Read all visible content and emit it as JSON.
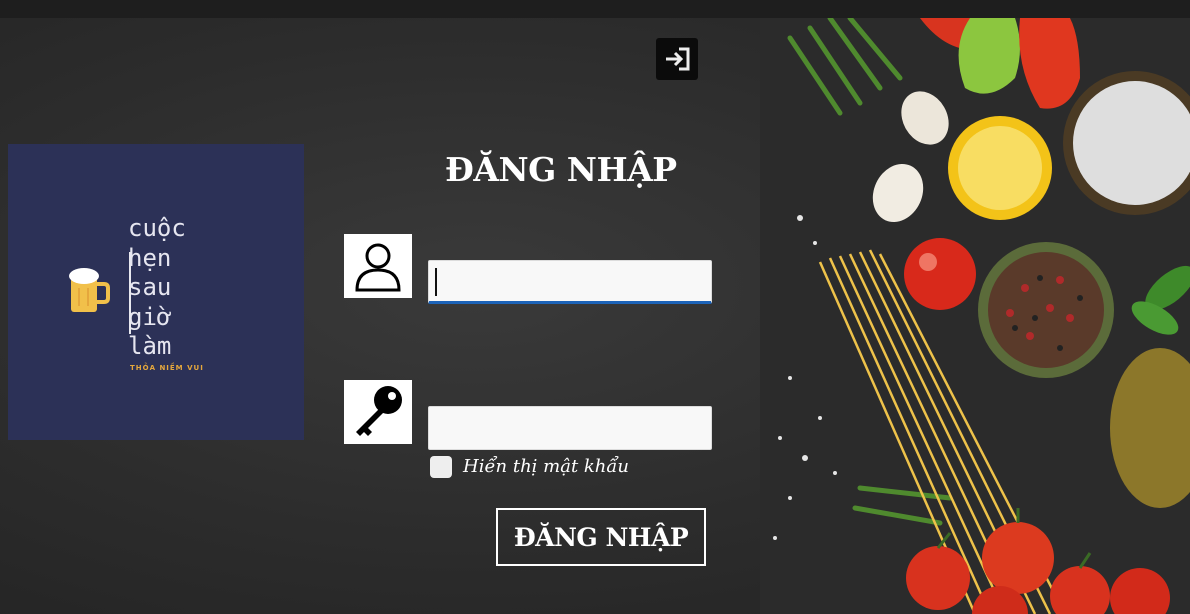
{
  "logo": {
    "lines": [
      "cuộc",
      "hẹn",
      "sau",
      "giờ",
      "làm"
    ],
    "tagline": "THỎA NIỀM VUI",
    "icon": "beer-mug-icon",
    "background_color": "#2c3157",
    "accent_color": "#e5a73c"
  },
  "header": {
    "exit_icon": "sign-in-icon"
  },
  "login_form": {
    "title": "ĐĂNG NHẬP",
    "username": {
      "icon": "user-icon",
      "value": "",
      "placeholder": ""
    },
    "password": {
      "icon": "key-icon",
      "value": "",
      "placeholder": ""
    },
    "show_password": {
      "label": "Hiển thị mật khẩu",
      "checked": false
    },
    "submit_label": "ĐĂNG NHẬP",
    "focus_color": "#1c63b8"
  }
}
